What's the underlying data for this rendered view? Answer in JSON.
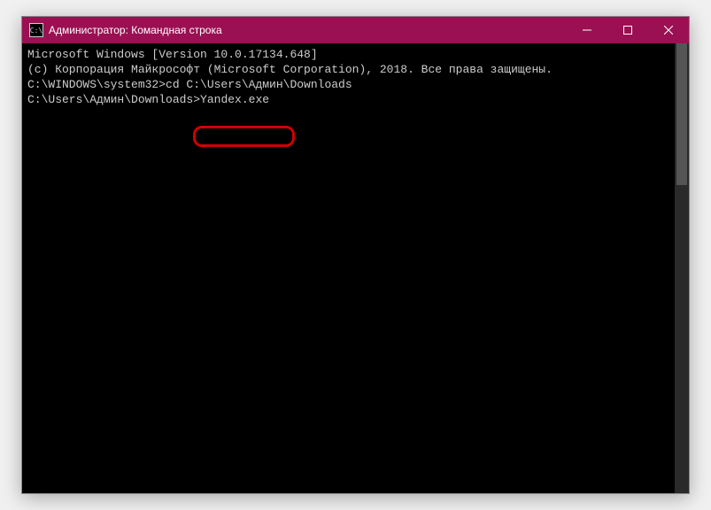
{
  "window": {
    "title": "Администратор: Командная строка",
    "icon_glyph": "C:\\"
  },
  "terminal": {
    "line1": "Microsoft Windows [Version 10.0.17134.648]",
    "line2": "(c) Корпорация Майкрософт (Microsoft Corporation), 2018. Все права защищены.",
    "line3": "",
    "line4": "C:\\WINDOWS\\system32>cd C:\\Users\\Админ\\Downloads",
    "line5": "",
    "prompt_path": "C:\\Users\\Админ\\Downloads>",
    "prompt_input": "Yandex.exe"
  },
  "controls": {
    "minimize": "─",
    "maximize": "☐",
    "close": "✕"
  }
}
